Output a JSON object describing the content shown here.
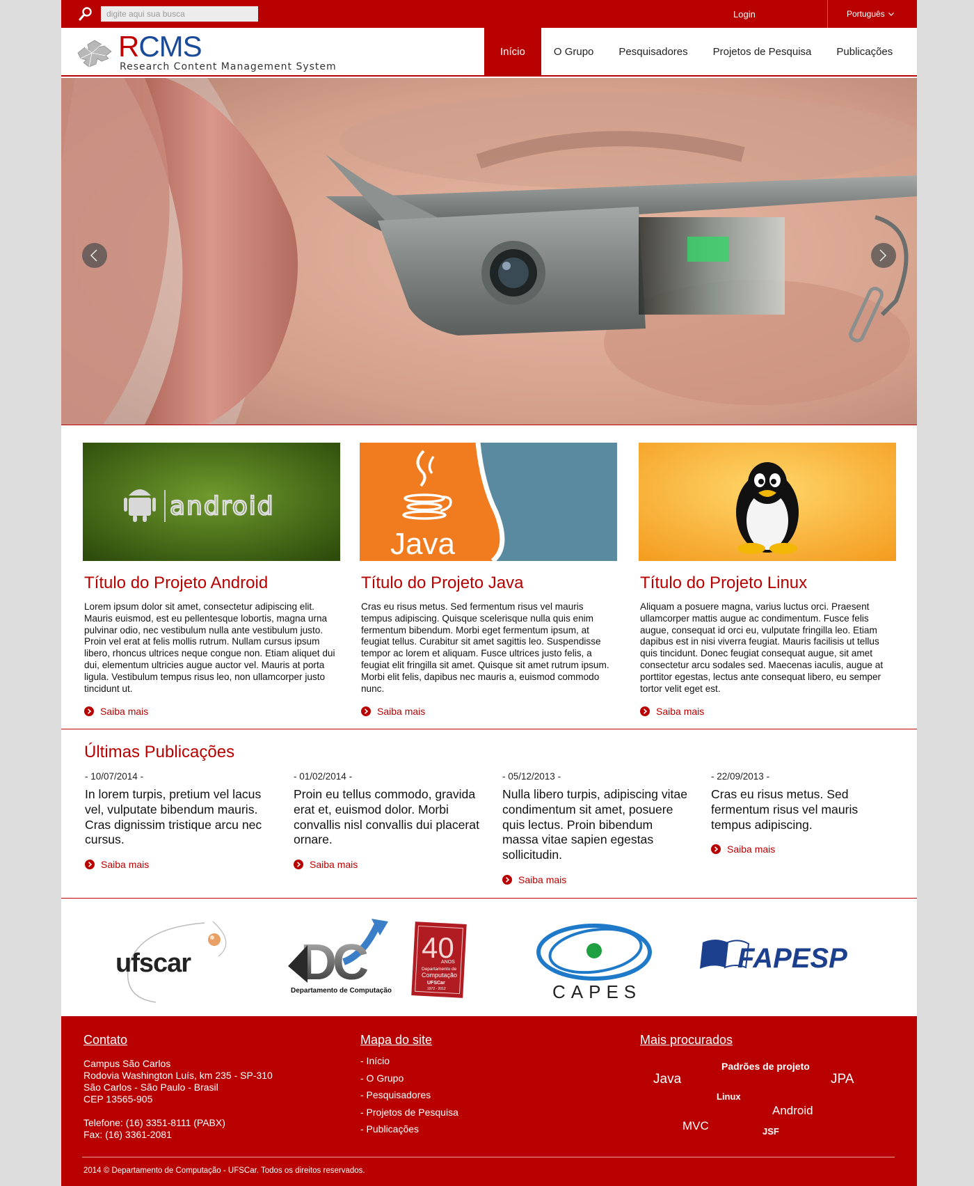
{
  "topbar": {
    "search_placeholder": "digite aqui sua busca",
    "login": "Login",
    "language": "Português"
  },
  "logo": {
    "title_r": "R",
    "title_rest": "CMS",
    "subtitle": "Research Content Management System"
  },
  "nav": {
    "items": [
      {
        "label": "Início"
      },
      {
        "label": "O Grupo"
      },
      {
        "label": "Pesquisadores"
      },
      {
        "label": "Projetos de Pesquisa"
      },
      {
        "label": "Publicações"
      }
    ]
  },
  "projects": [
    {
      "thumb_text": "android",
      "title": "Título do Projeto Android",
      "text": "Lorem ipsum dolor sit amet, consectetur adipiscing elit. Mauris euismod, est eu pellentesque lobortis, magna urna pulvinar odio, nec vestibulum nulla ante vestibulum justo. Proin vel erat at felis mollis rutrum. Nullam cursus ipsum libero, rhoncus ultrices neque congue non. Etiam aliquet dui dui, elementum ultricies augue auctor vel. Mauris at porta ligula. Vestibulum tempus risus leo, non ullamcorper justo tincidunt ut.",
      "more": "Saiba mais"
    },
    {
      "thumb_text": "Java",
      "title": "Título do Projeto Java",
      "text": "Cras eu risus metus. Sed fermentum risus vel mauris tempus adipiscing. Quisque scelerisque nulla quis enim fermentum bibendum. Morbi eget fermentum ipsum, at feugiat tellus. Curabitur sit amet sagittis leo. Suspendisse tempor ac lorem et aliquam. Fusce ultrices justo felis, a feugiat elit fringilla sit amet. Quisque sit amet rutrum ipsum. Morbi elit felis, dapibus nec mauris a, euismod commodo nunc.",
      "more": "Saiba mais"
    },
    {
      "title": "Título do Projeto Linux",
      "text": "Aliquam a posuere magna, varius luctus orci. Praesent ullamcorper mattis augue ac condimentum. Fusce felis augue, consequat id orci eu, vulputate fringilla leo. Etiam dapibus est in nisi viverra feugiat. Mauris facilisis ut tellus quis tincidunt. Donec feugiat consequat augue, sit amet consectetur arcu sodales sed. Maecenas iaculis, augue at porttitor egestas, lectus ante consequat libero, eu semper tortor velit eget est.",
      "more": "Saiba mais"
    }
  ],
  "publications": {
    "title": "Últimas Publicações",
    "items": [
      {
        "date": "- 10/07/2014 -",
        "title": "In lorem turpis, pretium vel lacus vel, vulputate bibendum mauris. Cras dignissim tristique arcu nec cursus.",
        "more": "Saiba mais"
      },
      {
        "date": "- 01/02/2014 -",
        "title": "Proin eu tellus commodo, gravida erat et, euismod dolor. Morbi convallis nisl convallis dui placerat ornare.",
        "more": "Saiba mais"
      },
      {
        "date": "- 05/12/2013 -",
        "title": "Nulla libero turpis, adipiscing vitae condimentum sit amet, posuere quis lectus. Proin bibendum massa vitae sapien egestas sollicitudin.",
        "more": "Saiba mais"
      },
      {
        "date": "- 22/09/2013 -",
        "title": "Cras eu risus metus. Sed fermentum risus vel mauris tempus adipiscing.",
        "more": "Saiba mais"
      }
    ]
  },
  "partners": {
    "ufscar": "ufscar",
    "dc_letters": "DC",
    "dc_caption": "Departamento de Computação",
    "dc40_number": "40",
    "dc40_anos": "ANOS",
    "dc40_line1": "Departamento de",
    "dc40_line2": "Computação",
    "dc40_line3": "UFSCar",
    "dc40_years": "1972 - 2012",
    "capes": "CAPES",
    "fapesp": "FAPESP"
  },
  "footer": {
    "contact_title": "Contato",
    "contact_lines": [
      "Campus São Carlos",
      "Rodovia Washington Luís, km 235 - SP-310",
      "São Carlos - São Paulo - Brasil",
      "CEP 13565-905",
      "",
      "Telefone: (16) 3351-8111 (PABX)",
      "Fax: (16) 3361-2081"
    ],
    "map_title": "Mapa do site",
    "map_items": [
      "- Início",
      "- O Grupo",
      "- Pesquisadores",
      "- Projetos de Pesquisa",
      "- Publicações"
    ],
    "popular_title": "Mais procurados",
    "tags": [
      "Java",
      "Padrões de projeto",
      "JPA",
      "Linux",
      "Android",
      "MVC",
      "JSF"
    ],
    "copyright": "2014 © Departamento de Computação - UFSCar. Todos os direitos reservados."
  },
  "colors": {
    "brand_red": "#b80000",
    "logo_blue": "#1a4a9a"
  },
  "icons": [
    "search-icon",
    "chevron-down-icon",
    "puzzle-logo-icon",
    "chevron-left-icon",
    "chevron-right-icon",
    "circle-arrow-icon"
  ]
}
